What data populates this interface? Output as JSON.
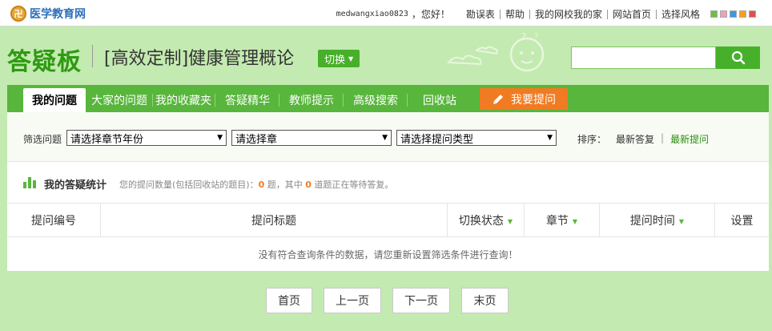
{
  "topbar": {
    "logo_mark": "卍",
    "logo_text": "医学教育网",
    "username": "medwangxiao0823",
    "greeting": "，您好！",
    "links": [
      "勘误表",
      "帮助",
      "我的网校我的家",
      "网站首页",
      "选择风格"
    ],
    "style_swatches": [
      "#6fbf3f",
      "#f0a0b4",
      "#3c98e0",
      "#f4a020",
      "#e05050"
    ]
  },
  "header": {
    "title": "答疑板",
    "course": "[高效定制]健康管理概论",
    "switch_label": "切换",
    "search_value": ""
  },
  "tabs": [
    "我的问题",
    "大家的问题",
    "我的收藏夹",
    "答疑精华",
    "教师提示",
    "高级搜索",
    "回收站"
  ],
  "ask_button": "我要提问",
  "filter": {
    "label": "筛选问题",
    "select_year": "请选择章节年份",
    "select_chapter": "请选择章",
    "select_type": "请选择提问类型",
    "sort_label": "排序：",
    "sort_options": [
      "最新答复",
      "最新提问"
    ]
  },
  "stats": {
    "title": "我的答疑统计",
    "text_prefix": "您的提问数量(包括回收站的题目)：",
    "count_total": "0",
    "text_mid": " 题，其中 ",
    "count_waiting": "0",
    "text_suffix": " 道题正在等待答复。"
  },
  "table": {
    "headers": [
      "提问编号",
      "提问标题",
      "切换状态",
      "章节",
      "提问时间",
      "设置"
    ],
    "empty_message": "没有符合查询条件的数据，请您重新设置筛选条件进行查询！"
  },
  "pagination": [
    "首页",
    "上一页",
    "下一页",
    "末页"
  ]
}
